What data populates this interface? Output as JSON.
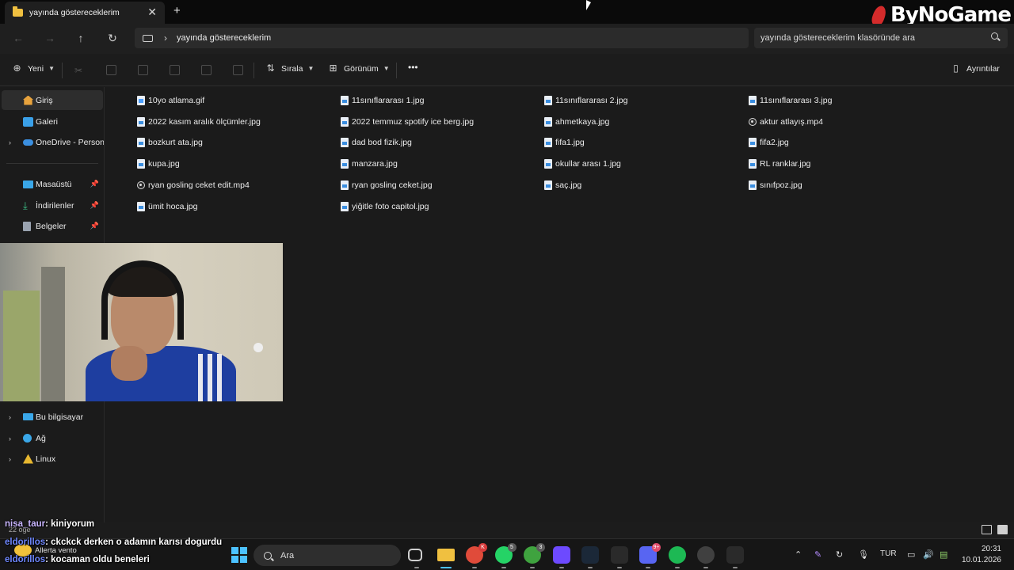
{
  "window": {
    "tab_title": "yayında göstereceklerim",
    "close_glyph": "✕",
    "new_tab_glyph": "+"
  },
  "brand": {
    "logo_text": "ByNoGame"
  },
  "address": {
    "path": "yayında göstereceklerim",
    "search_placeholder": "yayında göstereceklerim klasöründe ara"
  },
  "commands": {
    "new_label": "Yeni",
    "sort_label": "Sırala",
    "view_label": "Görünüm",
    "more_label": "•••",
    "details_label": "Ayrıntılar"
  },
  "sidebar": {
    "items": [
      {
        "label": "Giriş",
        "icon": "home-icon"
      },
      {
        "label": "Galeri",
        "icon": "gallery-icon"
      },
      {
        "label": "OneDrive - Persona",
        "icon": "cloud-icon"
      },
      {
        "label": "Masaüstü",
        "icon": "desktop-icon"
      },
      {
        "label": "İndirilenler",
        "icon": "download-icon"
      },
      {
        "label": "Belgeler",
        "icon": "documents-icon"
      },
      {
        "label": "Bu bilgisayar",
        "icon": "computer-icon"
      },
      {
        "label": "Ağ",
        "icon": "network-icon"
      },
      {
        "label": "Linux",
        "icon": "linux-icon"
      }
    ]
  },
  "files": [
    {
      "name": "10yo atlama.gif",
      "type": "gif"
    },
    {
      "name": "11sınıflararası 1.jpg",
      "type": "img"
    },
    {
      "name": "11sınıflararası 2.jpg",
      "type": "img"
    },
    {
      "name": "11sınıflararası 3.jpg",
      "type": "img"
    },
    {
      "name": "2022 kasım aralık ölçümler.jpg",
      "type": "img"
    },
    {
      "name": "2022 temmuz spotify ice berg.jpg",
      "type": "img"
    },
    {
      "name": "ahmetkaya.jpg",
      "type": "img"
    },
    {
      "name": "aktur atlayış.mp4",
      "type": "vid"
    },
    {
      "name": "bozkurt ata.jpg",
      "type": "img"
    },
    {
      "name": "dad bod fizik.jpg",
      "type": "img"
    },
    {
      "name": "fifa1.jpg",
      "type": "img"
    },
    {
      "name": "fifa2.jpg",
      "type": "img"
    },
    {
      "name": "kupa.jpg",
      "type": "img"
    },
    {
      "name": "manzara.jpg",
      "type": "img"
    },
    {
      "name": "okullar arası 1.jpg",
      "type": "img"
    },
    {
      "name": "RL ranklar.jpg",
      "type": "img"
    },
    {
      "name": "ryan gosling ceket edit.mp4",
      "type": "vid"
    },
    {
      "name": "ryan gosling ceket.jpg",
      "type": "img"
    },
    {
      "name": "saç.jpg",
      "type": "img"
    },
    {
      "name": "sınıfpoz.jpg",
      "type": "img"
    },
    {
      "name": "ümit hoca.jpg",
      "type": "img"
    },
    {
      "name": "yiğitle foto capitol.jpg",
      "type": "img"
    }
  ],
  "status": {
    "item_count": "22 öğe"
  },
  "chat": [
    {
      "user": "nisa_taur",
      "message": ": kiniyorum"
    },
    {
      "user": "eldorillos",
      "message": ": ckckck derken o adamın karısı dogurdu"
    },
    {
      "user": "eldorillos",
      "message": ": kocaman oldu beneleri"
    }
  ],
  "taskbar": {
    "weather_text": "Allerta vento",
    "search_label": "Ara",
    "apps": [
      {
        "name": "task-view-icon",
        "badge": ""
      },
      {
        "name": "file-explorer-icon",
        "badge": ""
      },
      {
        "name": "chrome-icon",
        "badge": "K"
      },
      {
        "name": "whatsapp-icon",
        "badge": "5"
      },
      {
        "name": "xbox-icon",
        "badge": "3"
      },
      {
        "name": "proton-icon",
        "badge": ""
      },
      {
        "name": "steam-icon",
        "badge": ""
      },
      {
        "name": "epic-games-icon",
        "badge": ""
      },
      {
        "name": "discord-icon",
        "badge": "9+"
      },
      {
        "name": "spotify-icon",
        "badge": ""
      },
      {
        "name": "obs-icon",
        "badge": ""
      },
      {
        "name": "epic-games-2-icon",
        "badge": ""
      }
    ],
    "language": "TUR",
    "time": "20:31",
    "date": "10.01.2026"
  },
  "colors": {
    "accent": "#4cc2ff",
    "chat_user_1": "#c9b6ff",
    "chat_user_2": "#6f88ff",
    "brand_red": "#d42b2b"
  }
}
